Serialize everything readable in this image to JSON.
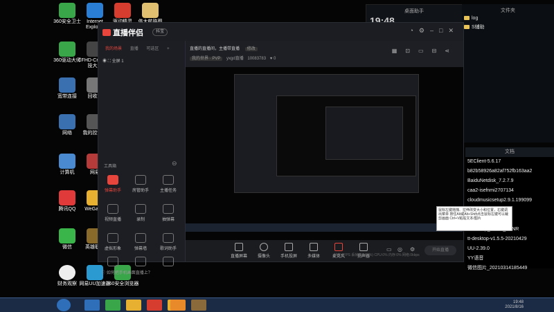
{
  "desktop_icons": [
    {
      "label": "360安全卫士",
      "color": "#3aa64a"
    },
    {
      "label": "Internet Explorer",
      "color": "#2a7fd4"
    },
    {
      "label": "驱动精灵",
      "color": "#d63d2f"
    },
    {
      "label": "伟大航路图",
      "color": "#e0c070"
    },
    {
      "label": "360驱动大师",
      "color": "#3aa64a"
    },
    {
      "label": "CFHD-Cross 竞技大厅",
      "color": "#444"
    },
    {
      "label": "宽带连接",
      "color": "#3a6fb0"
    },
    {
      "label": "回收站",
      "color": "#777"
    },
    {
      "label": "网络",
      "color": "#3a6fb0"
    },
    {
      "label": "我的控制器",
      "color": "#555"
    },
    {
      "label": "计算机",
      "color": "#4a8ad0"
    },
    {
      "label": "网易",
      "color": "#b53a3a"
    },
    {
      "label": "腾讯QQ",
      "color": "#e03a3a"
    },
    {
      "label": "WeGame",
      "color": "#e8b030"
    },
    {
      "label": "微信",
      "color": "#3ab54a"
    },
    {
      "label": "英雄联盟",
      "color": "#8a6a2a"
    },
    {
      "label": "财务观察",
      "color": "#eeeeee"
    },
    {
      "label": "网易UU加速器",
      "color": "#2a9ad0"
    },
    {
      "label": "360安全浏览器",
      "color": "#3aa64a"
    }
  ],
  "widget": {
    "title": "桌面助手",
    "clock": "19:48"
  },
  "top_files": {
    "title": "文件夹",
    "items": [
      "log",
      "S辅助"
    ]
  },
  "file_list": {
    "title": "文档",
    "items": [
      "5EClient-5.6.17",
      "b82b58926a82af752fb163aa2",
      "BaiduNetdisk_7.2.7.9",
      "caa2-isefnmi2707134",
      "cloudmusicsetup2.9.1.199099",
      "",
      "",
      "DGSetup_Home_BZNR",
      "tt-desktop-v1.5.5-20210429",
      "UU-2.39.0",
      "YY语音",
      "微信图片_20210314185449"
    ]
  },
  "app": {
    "name": "直播伴侣",
    "version_pill": "抖宝",
    "left_tabs": [
      "我的场景",
      "直播",
      "可选区"
    ],
    "scene": "全屏 1",
    "tools_title": "工具箱",
    "tools": [
      {
        "label": "弹幕助手",
        "hot": true
      },
      {
        "label": "房管助手",
        "hot": false
      },
      {
        "label": "主播任务",
        "hot": false
      },
      {
        "label": "视频直播",
        "hot": false
      },
      {
        "label": "录制",
        "hot": false
      },
      {
        "label": "抽弹幕",
        "hot": false
      },
      {
        "label": "虚拟形象",
        "hot": false
      },
      {
        "label": "弹幕墙",
        "hot": false
      },
      {
        "label": "歌词助手",
        "hot": false
      },
      {
        "label": "",
        "hot": false
      },
      {
        "label": "",
        "hot": false
      },
      {
        "label": "",
        "hot": false
      }
    ],
    "notice": "如何把手机画面直播上？",
    "room_title": "直播的直播间，主播带直播",
    "room_edit": "修改",
    "room_tag": "我的世界 · PVP",
    "room_user": "yxgd直播",
    "room_id": "10083783",
    "room_likes": "0",
    "bottom_buttons": [
      "直播屏幕",
      "摄像头",
      "手机投屏",
      "多媒体",
      "麦克风",
      "扬声器"
    ],
    "start_label": "开始直播",
    "status": "帧率:0FPS  丢帧:0(0.00%)  CPU:0%  内存:0%  网络:0kbps",
    "tooltip": "鼠标左键拖拽、拉伸改变大小和位置，右键调出菜单 按住Alt或Alt+Shift点击鼠标左键可以裁剪画面 Ctrl+V粘贴文本/图片"
  },
  "taskbar": {
    "time": "19:48",
    "date": "2021/8/16",
    "apps": [
      {
        "name": "windows-media",
        "color": "#2f6fba"
      },
      {
        "name": "media-player",
        "color": "#3aa64a"
      },
      {
        "name": "g-app",
        "color": "#e8b030"
      },
      {
        "name": "netease-music",
        "color": "#d63d2f"
      },
      {
        "name": "g-app-2",
        "color": "#e8b030"
      },
      {
        "name": "help",
        "color": "#e88a2a"
      },
      {
        "name": "minecraft",
        "color": "#8a6a3a"
      }
    ]
  }
}
